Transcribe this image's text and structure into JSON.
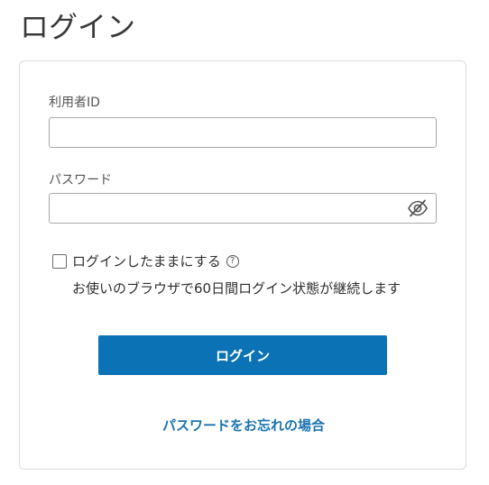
{
  "page": {
    "title": "ログイン"
  },
  "form": {
    "user_id_label": "利用者ID",
    "user_id_value": "",
    "password_label": "パスワード",
    "password_value": "",
    "password_toggle_icon": "eye-slash-icon",
    "remember_label": "ログインしたままにする",
    "remember_checked": false,
    "help_icon": "question-circle-icon",
    "help_glyph": "?",
    "remember_note": "お使いのブラウザで60日間ログイン状態が継続します",
    "submit_label": "ログイン",
    "forgot_link": "パスワードをお忘れの場合"
  },
  "colors": {
    "primary_button": "#0b72b5",
    "link": "#1a74b0",
    "border": "#a8a8a8",
    "card_border": "#dcdcdc"
  }
}
